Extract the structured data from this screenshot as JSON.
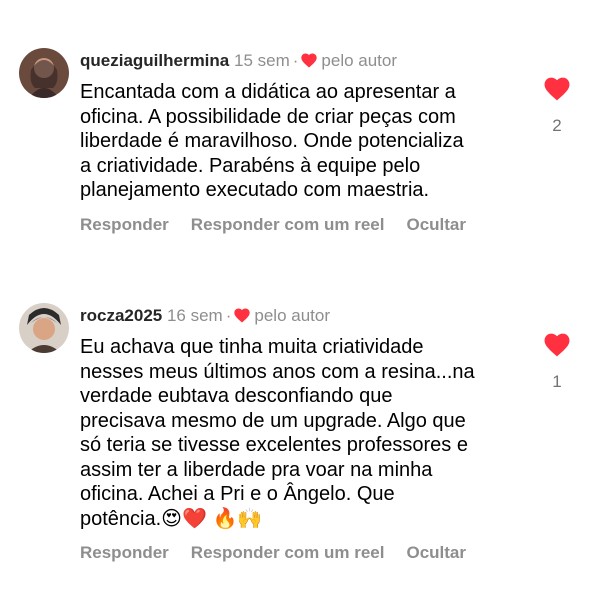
{
  "comments": [
    {
      "username": "queziaguilhermina",
      "time": "15 sem",
      "author_label": "pelo autor",
      "text": "Encantada com a didática ao apresentar a\noficina. A possibilidade de criar peças com\nliberdade é maravilhoso. Onde potencializa\na criatividade. Parabéns à equipe pelo\nplanejamento executado com maestria.",
      "actions": {
        "reply": "Responder",
        "reply_reel": "Responder com um reel",
        "hide": "Ocultar"
      },
      "likes": "2"
    },
    {
      "username": "rocza2025",
      "time": "16 sem",
      "author_label": "pelo autor",
      "text": "Eu achava que tinha muita criatividade\nnesses meus últimos anos com a resina...na\nverdade eubtava desconfiando que\nprecisava mesmo de um upgrade. Algo que\nsó teria se tivesse excelentes professores e\nassim ter a liberdade pra voar na minha\noficina. Achei a Pri e o Ângelo. Que\npotência.",
      "emojis": "😍❤️ 🔥🙌",
      "actions": {
        "reply": "Responder",
        "reply_reel": "Responder com um reel",
        "hide": "Ocultar"
      },
      "likes": "1"
    }
  ],
  "colors": {
    "heart": "#ff3040",
    "secondary_text": "#8e8e8e",
    "primary_text": "#000000"
  },
  "icons": {
    "author_heart": "heart-icon",
    "like_button": "heart-icon"
  }
}
